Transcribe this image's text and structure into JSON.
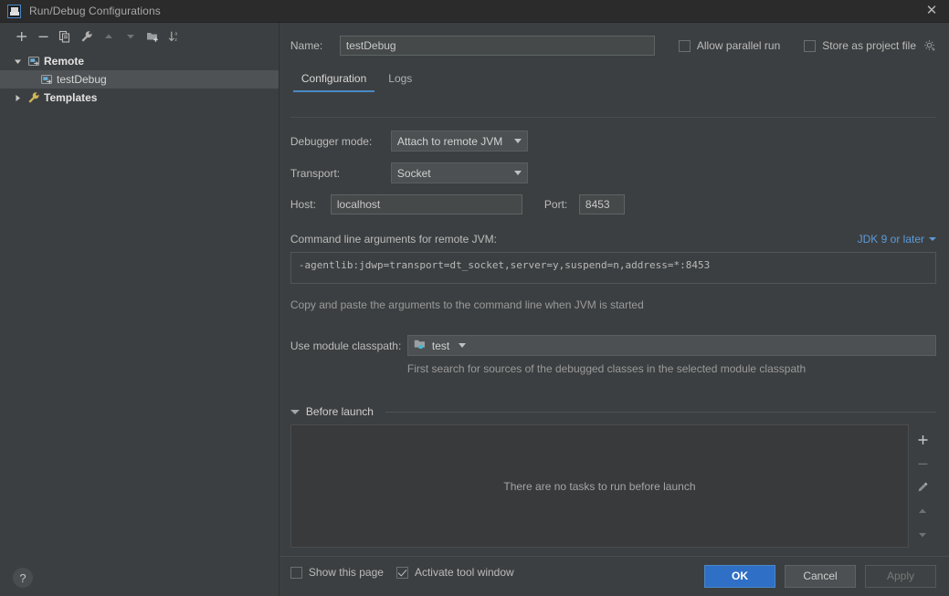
{
  "window": {
    "title": "Run/Debug Configurations",
    "logo_icon": "intellij-idea-logo",
    "close_icon": "close-icon"
  },
  "sidebar": {
    "toolbar": [
      {
        "name": "add-configuration-button",
        "icon": "plus-icon",
        "label": "+"
      },
      {
        "name": "remove-configuration-button",
        "icon": "minus-icon",
        "label": "−"
      },
      {
        "name": "copy-configuration-button",
        "icon": "copy-icon",
        "label": "copy"
      },
      {
        "name": "edit-templates-button",
        "icon": "wrench-icon",
        "label": "wrench"
      },
      {
        "name": "move-up-button",
        "icon": "arrow-up-icon",
        "label": "up"
      },
      {
        "name": "move-down-button",
        "icon": "arrow-down-icon",
        "label": "down"
      },
      {
        "name": "new-folder-button",
        "icon": "folder-add-icon",
        "label": "folder"
      },
      {
        "name": "sort-configurations-button",
        "icon": "sort-alphabetically-icon",
        "label": "sort"
      }
    ],
    "tree": [
      {
        "label": "Remote",
        "icon": "remote-configuration-icon",
        "expanded": true,
        "bold": true,
        "selected": false,
        "child": false
      },
      {
        "label": "testDebug",
        "icon": "remote-configuration-icon",
        "expanded": null,
        "bold": false,
        "selected": true,
        "child": true
      },
      {
        "label": "Templates",
        "icon": "wrench-icon",
        "expanded": false,
        "bold": true,
        "selected": false,
        "child": false
      }
    ],
    "help_button": "?"
  },
  "form": {
    "name_label": "Name:",
    "name_value": "testDebug",
    "allow_parallel_run": {
      "label": "Allow parallel run",
      "checked": false
    },
    "store_as_project_file": {
      "label": "Store as project file",
      "checked": false,
      "icon": "gear-icon"
    },
    "tabs": [
      {
        "label": "Configuration",
        "active": true
      },
      {
        "label": "Logs",
        "active": false
      }
    ],
    "debugger_mode_label": "Debugger mode:",
    "debugger_mode_value": "Attach to remote JVM",
    "transport_label": "Transport:",
    "transport_value": "Socket",
    "host_label": "Host:",
    "host_value": "localhost",
    "port_label": "Port:",
    "port_value": "8453",
    "command_line_title": "Command line arguments for remote JVM:",
    "jdk_link": "JDK 9 or later",
    "command_line_value": "-agentlib:jdwp=transport=dt_socket,server=y,suspend=n,address=*:8453",
    "command_line_hint": "Copy and paste the arguments to the command line when JVM is started",
    "module_classpath_label": "Use module classpath:",
    "module_classpath_value": "test",
    "module_classpath_icon": "module-folder-icon",
    "module_classpath_hint": "First search for sources of the debugged classes in the selected module classpath"
  },
  "before_launch": {
    "title": "Before launch",
    "empty_text": "There are no tasks to run before launch",
    "toolbar": [
      {
        "name": "add-task-button",
        "icon": "plus-icon"
      },
      {
        "name": "remove-task-button",
        "icon": "minus-icon"
      },
      {
        "name": "edit-task-button",
        "icon": "pencil-icon"
      },
      {
        "name": "move-task-up-button",
        "icon": "arrow-up-icon"
      },
      {
        "name": "move-task-down-button",
        "icon": "arrow-down-icon"
      }
    ],
    "show_this_page": {
      "label": "Show this page",
      "checked": false
    },
    "activate_tool_window": {
      "label": "Activate tool window",
      "checked": true
    }
  },
  "buttons": {
    "ok": "OK",
    "cancel": "Cancel",
    "apply": "Apply"
  },
  "colors": {
    "background": "#3c3f41",
    "titlebar": "#2b2b2b",
    "accent_blue": "#4a88c7",
    "link_blue": "#5b9bd9",
    "primary_button": "#2f6fc5",
    "selection": "#4e5254"
  }
}
